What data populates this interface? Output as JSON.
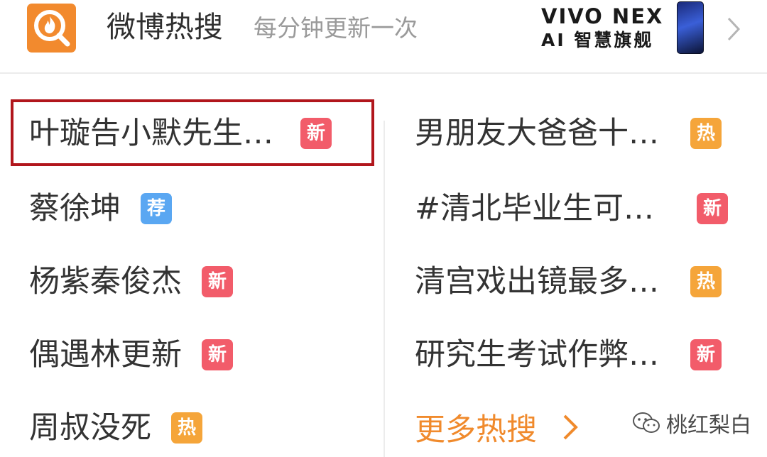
{
  "header": {
    "title": "微博热搜",
    "subtitle": "每分钟更新一次",
    "ad": {
      "brand": "VIVO NEX",
      "tagline": "AI 智慧旗舰"
    }
  },
  "colors": {
    "accent_orange": "#f28a2e",
    "badge_new": "#f25c6a",
    "badge_hot": "#f5a53a",
    "badge_recommended": "#5aa7f2",
    "highlight_border": "#b1161c"
  },
  "left_column": [
    {
      "label": "叶璇告小默先生…",
      "badge": "新",
      "badge_type": "new"
    },
    {
      "label": "蔡徐坤",
      "badge": "荐",
      "badge_type": "recommended"
    },
    {
      "label": "杨紫秦俊杰",
      "badge": "新",
      "badge_type": "new"
    },
    {
      "label": "偶遇林更新",
      "badge": "新",
      "badge_type": "new"
    },
    {
      "label": "周叔没死",
      "badge": "热",
      "badge_type": "hot"
    }
  ],
  "right_column": [
    {
      "label": "男朋友大爸爸十…",
      "badge": "热",
      "badge_type": "hot"
    },
    {
      "label": "#清北毕业生可…",
      "badge": "新",
      "badge_type": "new"
    },
    {
      "label": "清宫戏出镜最多…",
      "badge": "热",
      "badge_type": "hot"
    },
    {
      "label": "研究生考试作弊…",
      "badge": "新",
      "badge_type": "new"
    }
  ],
  "more_link": {
    "label": "更多热搜"
  },
  "watermark": {
    "text": "桃红梨白",
    "icon": "wechat-icon"
  },
  "icons": {
    "app": "weibo-hot-search-icon",
    "header_chevron": "chevron-right-icon",
    "more_chevron": "chevron-right-icon"
  }
}
